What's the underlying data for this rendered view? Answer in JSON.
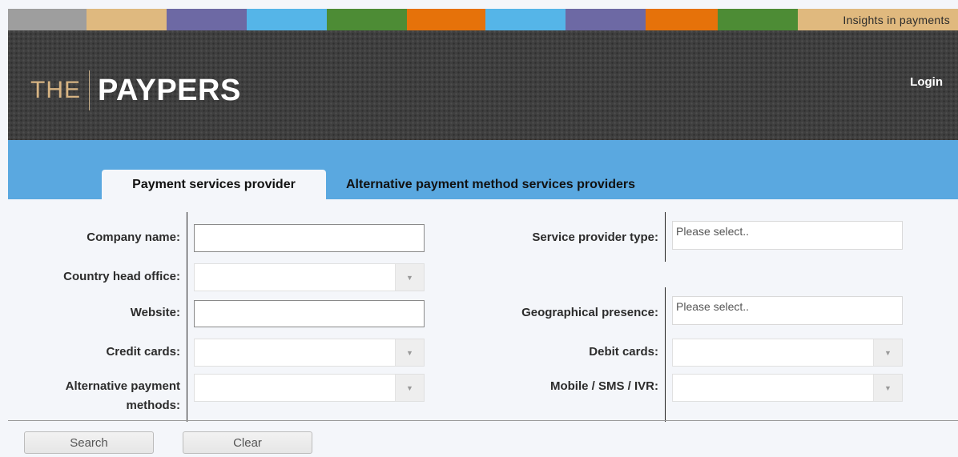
{
  "stripe": {
    "colors": [
      "#9e9e9e",
      "#dfb97f",
      "#6d69a4",
      "#55b5e8",
      "#4d8c35",
      "#e6720a",
      "#55b5e8",
      "#6d69a4",
      "#e6720a",
      "#4d8c35"
    ],
    "tagline": "Insights in payments"
  },
  "header": {
    "logo_the": "THE",
    "logo_paypers": "PAYPERS",
    "login": "Login"
  },
  "tabs": {
    "active": "Payment services provider",
    "inactive": "Alternative payment method services providers"
  },
  "form": {
    "left": {
      "company_name": "Company name:",
      "country_head_office": "Country head office:",
      "website": "Website:",
      "credit_cards": "Credit cards:",
      "alt_payment_line1": "Alternative payment",
      "alt_payment_line2": "methods:"
    },
    "right": {
      "service_provider_type": "Service provider type:",
      "service_provider_placeholder": "Please select..",
      "geographical_presence": "Geographical presence:",
      "geographical_placeholder": "Please select..",
      "debit_cards": "Debit cards:",
      "mobile_sms_ivr": "Mobile / SMS / IVR:"
    }
  },
  "buttons": {
    "search": "Search",
    "clear": "Clear"
  }
}
